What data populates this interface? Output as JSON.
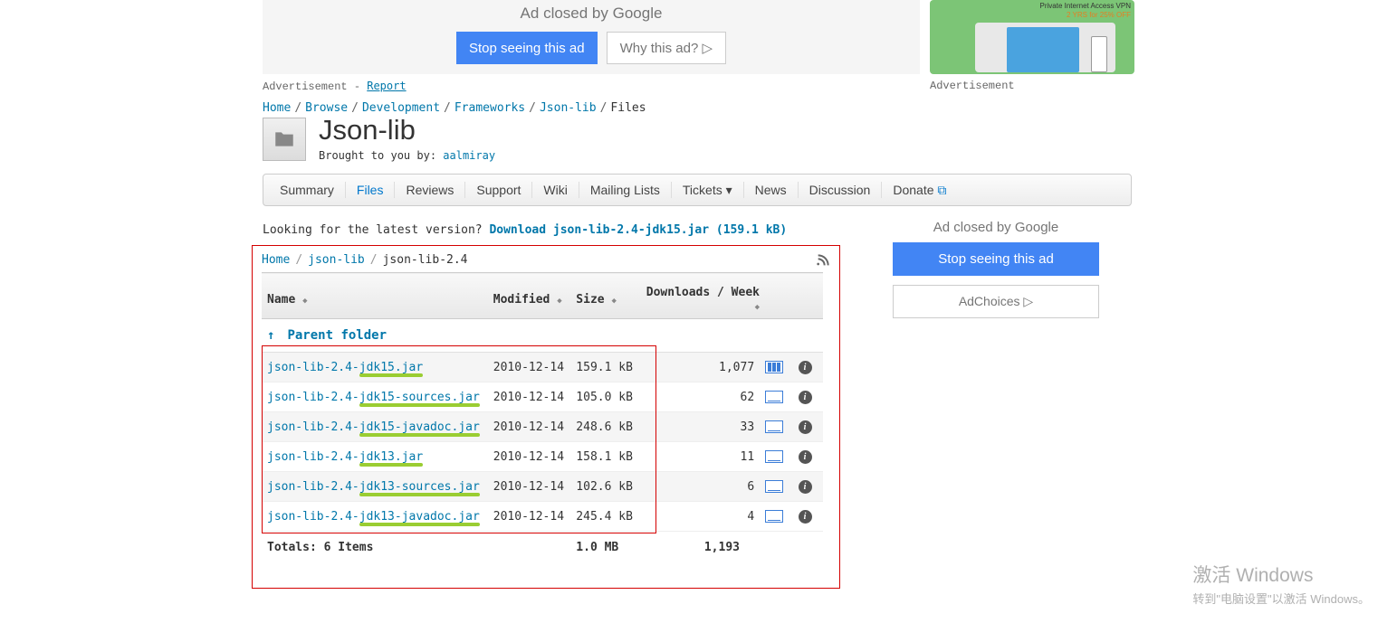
{
  "topAd": {
    "closed": "Ad closed by ",
    "google": "Google",
    "stop": "Stop seeing this ad",
    "why": "Why this ad? ▷"
  },
  "topAdRight": {
    "line1": "Private Internet Access VPN",
    "line2": "2 YRS for 25% OFF"
  },
  "advLabel": "Advertisement",
  "reportDash": " - ",
  "report": "Report",
  "crumbs": {
    "home": "Home",
    "browse": "Browse",
    "dev": "Development",
    "fw": "Frameworks",
    "jsonlib": "Json-lib",
    "files": "Files"
  },
  "project": {
    "title": "Json-lib",
    "brought": "Brought to you by: ",
    "author": "aalmiray"
  },
  "tabs": {
    "summary": "Summary",
    "files": "Files",
    "reviews": "Reviews",
    "support": "Support",
    "wiki": "Wiki",
    "mailing": "Mailing Lists",
    "tickets": "Tickets ▾",
    "news": "News",
    "discussion": "Discussion",
    "donate": "Donate"
  },
  "latest": {
    "prompt": "Looking for the latest version? ",
    "link": "Download json-lib-2.4-jdk15.jar (159.1 kB)"
  },
  "filesCrumb": {
    "home": "Home",
    "jsonlib": "json-lib",
    "current": "json-lib-2.4"
  },
  "headers": {
    "name": "Name",
    "modified": "Modified",
    "size": "Size",
    "downloads": "Downloads / Week"
  },
  "parentFolder": "Parent folder",
  "files": [
    {
      "name_a": "json-lib-2.4-",
      "name_b": "jdk15.jar",
      "modified": "2010-12-14",
      "size": "159.1 kB",
      "dl": "1,077",
      "big": true
    },
    {
      "name_a": "json-lib-2.4-",
      "name_b": "jdk15-sources.jar",
      "modified": "2010-12-14",
      "size": "105.0 kB",
      "dl": "62",
      "big": false
    },
    {
      "name_a": "json-lib-2.4-",
      "name_b": "jdk15-javadoc.jar",
      "modified": "2010-12-14",
      "size": "248.6 kB",
      "dl": "33",
      "big": false
    },
    {
      "name_a": "json-lib-2.4-",
      "name_b": "jdk13.jar",
      "modified": "2010-12-14",
      "size": "158.1 kB",
      "dl": "11",
      "big": false
    },
    {
      "name_a": "json-lib-2.4-",
      "name_b": "jdk13-sources.jar",
      "modified": "2010-12-14",
      "size": "102.6 kB",
      "dl": "6",
      "big": false
    },
    {
      "name_a": "json-lib-2.4-",
      "name_b": "jdk13-javadoc.jar",
      "modified": "2010-12-14",
      "size": "245.4 kB",
      "dl": "4",
      "big": false
    }
  ],
  "totals": {
    "label": "Totals: 6 Items",
    "size": "1.0 MB",
    "dl": "1,193"
  },
  "sideAd": {
    "closed": "Ad closed by ",
    "google": "Google",
    "stop": "Stop seeing this ad",
    "choices": "AdChoices ▷"
  },
  "watermark": {
    "l1": "激活 Windows",
    "l2": "转到\"电脑设置\"以激活 Windows。"
  }
}
